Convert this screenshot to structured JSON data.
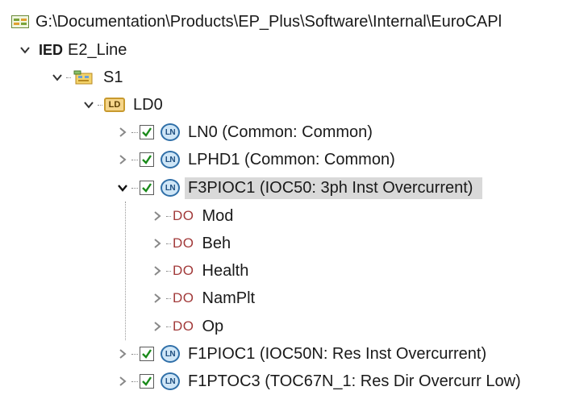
{
  "path": {
    "text": "G:\\Documentation\\Products\\EP_Plus\\Software\\Internal\\EuroCAPl"
  },
  "ied": {
    "tag": "IED",
    "label": "E2_Line"
  },
  "server": {
    "label": "S1"
  },
  "ld": {
    "icon_text": "LD",
    "label": "LD0"
  },
  "logical_nodes": [
    {
      "icon_text": "LN",
      "label": "LN0 (Common: Common)"
    },
    {
      "icon_text": "LN",
      "label": "LPHD1 (Common: Common)"
    },
    {
      "icon_text": "LN",
      "label": "F3PIOC1 (IOC50: 3ph Inst Overcurrent)"
    },
    {
      "icon_text": "LN",
      "label": "F1PIOC1 (IOC50N: Res Inst Overcurrent)"
    },
    {
      "icon_text": "LN",
      "label": "F1PTOC3 (TOC67N_1: Res Dir Overcurr Low)"
    }
  ],
  "data_objects": [
    {
      "tag": "DO",
      "label": "Mod"
    },
    {
      "tag": "DO",
      "label": "Beh"
    },
    {
      "tag": "DO",
      "label": "Health"
    },
    {
      "tag": "DO",
      "label": "NamPlt"
    },
    {
      "tag": "DO",
      "label": "Op"
    }
  ],
  "colors": {
    "selection": "#d9d9d9",
    "check": "#1a8a1a",
    "do_tag": "#a23a3a"
  }
}
